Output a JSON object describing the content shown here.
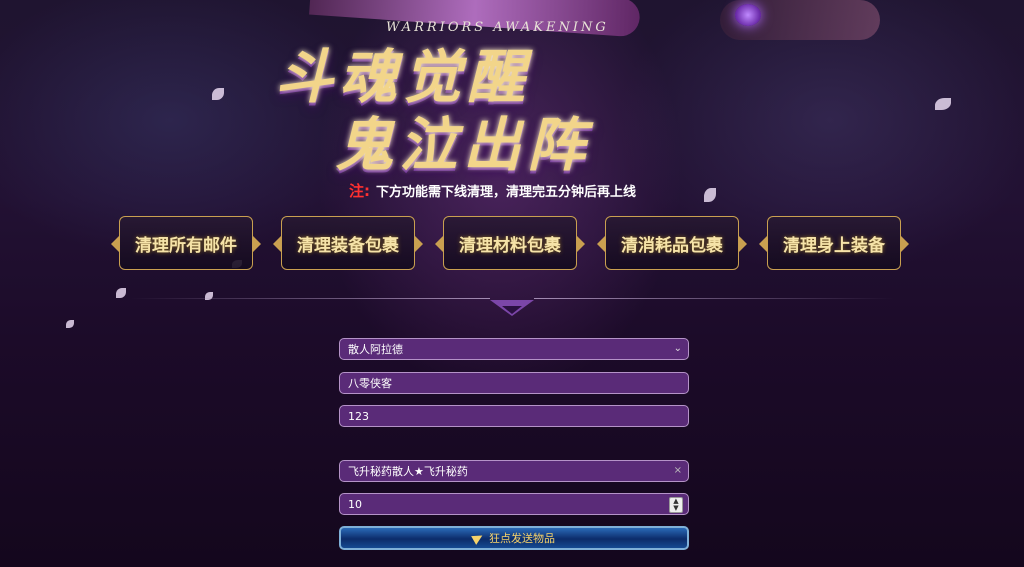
{
  "header": {
    "subtitle": "WARRIORS AWAKENING",
    "title_line1": "斗魂觉醒",
    "title_line2": "鬼泣出阵"
  },
  "notice": {
    "label": "注:",
    "text": "下方功能需下线清理，清理完五分钟后再上线"
  },
  "actions": [
    {
      "label": "清理所有邮件"
    },
    {
      "label": "清理装备包裹"
    },
    {
      "label": "清理材料包裹"
    },
    {
      "label": "清消耗品包裹"
    },
    {
      "label": "清理身上装备"
    }
  ],
  "form": {
    "character_select": "散人阿拉德",
    "account_name": "八零侠客",
    "password": "123",
    "item_select": "飞升秘药散人★飞升秘药",
    "clear_mark": "×",
    "quantity": "10",
    "submit_label": "狂点发送物品"
  },
  "icons": {
    "select_arrow": "chevron-down-icon",
    "stepper": "number-stepper-icon",
    "submit": "paper-plane-icon"
  },
  "colors": {
    "field_bg": "#5a2b78",
    "button_border": "#c9a050",
    "notice_label": "#ff3030",
    "submit_text": "#f6d26a"
  }
}
